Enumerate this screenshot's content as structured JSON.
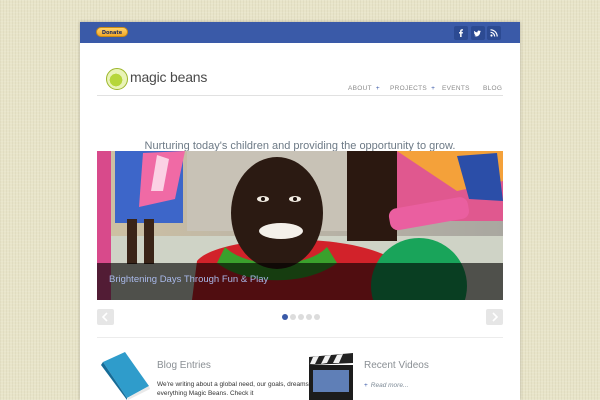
{
  "topbar": {
    "donate_label": "Donate",
    "social": [
      "facebook-icon",
      "twitter-icon",
      "rss-icon"
    ]
  },
  "header": {
    "logo_text": "magic beans",
    "nav": [
      {
        "label": "ABOUT",
        "has_submenu": true
      },
      {
        "label": "PROJECTS",
        "has_submenu": true
      },
      {
        "label": "EVENTS",
        "has_submenu": false
      },
      {
        "label": "BLOG",
        "has_submenu": false
      }
    ],
    "submenu_marker": "+"
  },
  "tagline": "Nurturing today's children and providing the opportunity to grow.",
  "slider": {
    "caption": "Brightening Days Through Fun & Play",
    "slide_count": 5,
    "active_slide": 1
  },
  "blog": {
    "title": "Blog Entries",
    "text": "We're writing about a global need, our goals, dreams & everything Magic Beans. Check it"
  },
  "videos": {
    "title": "Recent Videos",
    "read_more": "Read more..."
  },
  "colors": {
    "accent": "#3a5aa8",
    "background": "#e8e4c9"
  }
}
